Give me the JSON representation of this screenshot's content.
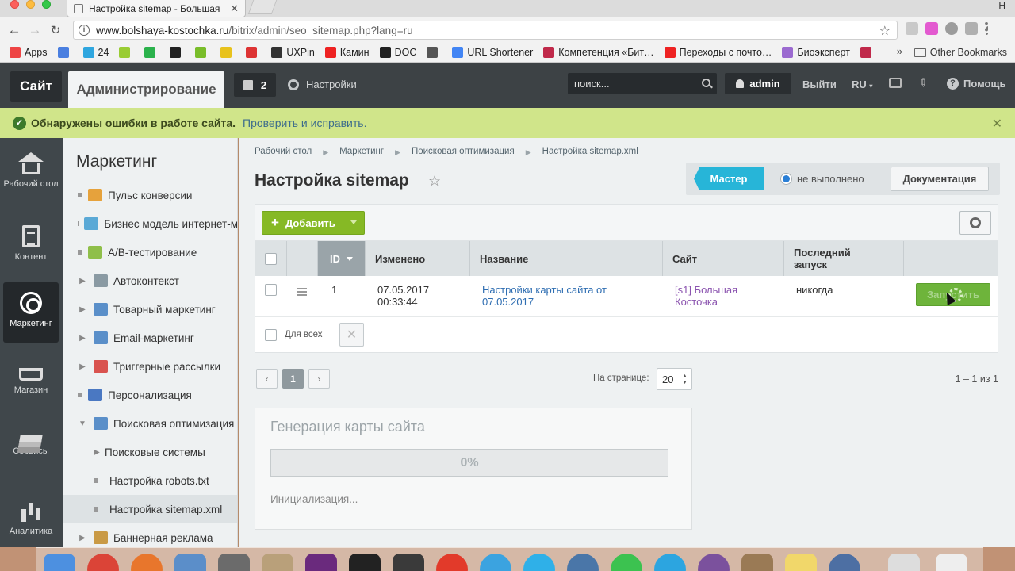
{
  "browser": {
    "tab_title": "Настройка sitemap - Большая",
    "window_letter": "H",
    "url_host": "www.bolshaya-kostochka.ru",
    "url_path": "/bitrix/admin/seo_sitemap.php?lang=ru",
    "bookmarks": [
      {
        "label": "Apps",
        "icon": "apps-grid-icon",
        "color": "#e44"
      },
      {
        "label": "",
        "icon": "translate-icon",
        "color": "#4a7fe0"
      },
      {
        "label": "24",
        "icon": "bitrix24-icon",
        "color": "#2fa6df"
      },
      {
        "label": "",
        "icon": "extension-icon",
        "color": "#9c3"
      },
      {
        "label": "",
        "icon": "evernote-icon",
        "color": "#2bb24c"
      },
      {
        "label": "",
        "icon": "tool-icon",
        "color": "#222"
      },
      {
        "label": "",
        "icon": "feedly-icon",
        "color": "#79bd2a"
      },
      {
        "label": "",
        "icon": "shield-icon",
        "color": "#e8c21c"
      },
      {
        "label": "",
        "icon": "letter-a-icon",
        "color": "#d33"
      },
      {
        "label": "UXPin",
        "icon": "uxpin-icon",
        "color": "#333"
      },
      {
        "label": "Камин",
        "icon": "youtube-icon",
        "color": "#e22"
      },
      {
        "label": "DOC",
        "icon": "doc-icon",
        "color": "#222"
      },
      {
        "label": "",
        "icon": "chart-icon",
        "color": "#555"
      },
      {
        "label": "URL Shortener",
        "icon": "google-icon",
        "color": "#4285f4"
      },
      {
        "label": "Компетенция «Бит…",
        "icon": "competence-icon",
        "color": "#c0294a"
      },
      {
        "label": "Переходы с почто…",
        "icon": "yandex-icon",
        "color": "#e22"
      },
      {
        "label": "Биоэксперт",
        "icon": "bioexpert-icon",
        "color": "#9b6ad0"
      },
      {
        "label": "",
        "icon": "competence-icon",
        "color": "#c0294a"
      }
    ],
    "more": "»",
    "other_bookmarks": "Other Bookmarks"
  },
  "admin_panel": {
    "site_label": "Сайт",
    "admin_label": "Администрирование",
    "notifications_count": "2",
    "settings_label": "Настройки",
    "search_placeholder": "поиск...",
    "user": "admin",
    "logout": "Выйти",
    "lang": "RU",
    "help": "Помощь"
  },
  "error_bar": {
    "message": "Обнаружены ошибки в работе сайта.",
    "link": "Проверить и исправить."
  },
  "iconbar": [
    {
      "label": "Рабочий стол",
      "icon": "home-icon",
      "active": false
    },
    {
      "label": "Контент",
      "icon": "document-icon",
      "active": false
    },
    {
      "label": "Маркетинг",
      "icon": "target-icon",
      "active": true
    },
    {
      "label": "Магазин",
      "icon": "basket-icon",
      "active": false
    },
    {
      "label": "Сервисы",
      "icon": "layers-icon",
      "active": false
    },
    {
      "label": "Аналитика",
      "icon": "bar-chart-icon",
      "active": false
    }
  ],
  "menu": {
    "title": "Маркетинг",
    "items": [
      {
        "label": "Пульс конверсии",
        "marker": "dot",
        "icon_color": "#e6a23c"
      },
      {
        "label": "Бизнес модель интернет-м",
        "marker": "dot",
        "icon_color": "#5aa9d6"
      },
      {
        "label": "A/B-тестирование",
        "marker": "dot",
        "icon_color": "#8fbf4a"
      },
      {
        "label": "Автоконтекст",
        "marker": "arrow",
        "icon_color": "#8a9aa3"
      },
      {
        "label": "Товарный маркетинг",
        "marker": "arrow",
        "icon_color": "#5a8fc9"
      },
      {
        "label": "Email-маркетинг",
        "marker": "arrow",
        "icon_color": "#5a8fc9"
      },
      {
        "label": "Триггерные рассылки",
        "marker": "arrow",
        "icon_color": "#d9534f"
      },
      {
        "label": "Персонализация",
        "marker": "dot",
        "icon_color": "#4a78c2"
      },
      {
        "label": "Поисковая оптимизация",
        "marker": "open",
        "icon_color": "#5a8fc9"
      },
      {
        "label": "Поисковые системы",
        "marker": "sub-arrow"
      },
      {
        "label": "Настройка robots.txt",
        "marker": "sub-dot"
      },
      {
        "label": "Настройка sitemap.xml",
        "marker": "sub-dot",
        "active": true
      },
      {
        "label": "Баннерная реклама",
        "marker": "arrow",
        "icon_color": "#c99a45"
      }
    ]
  },
  "breadcrumb": [
    "Рабочий стол",
    "Маркетинг",
    "Поисковая оптимизация",
    "Настройка sitemap.xml"
  ],
  "page": {
    "title": "Настройка sitemap",
    "master_label": "Мастер",
    "master_status": "не выполнено",
    "docs_label": "Документация"
  },
  "grid": {
    "add_label": "Добавить",
    "columns": [
      "ID",
      "Изменено",
      "Название",
      "Сайт",
      "Последний запуск"
    ],
    "rows": [
      {
        "id": "1",
        "modified": "07.05.2017 00:33:44",
        "name": "Настройки карты сайта от 07.05.2017",
        "site": "[s1] Большая Косточка",
        "last_run": "никогда",
        "action": "Запустить"
      }
    ],
    "for_all": "Для всех"
  },
  "pager": {
    "prev": "‹",
    "current": "1",
    "next": "›",
    "per_page_label": "На странице:",
    "per_page": "20",
    "total": "1 – 1 из 1"
  },
  "generation": {
    "title": "Генерация карты сайта",
    "progress_text": "0%",
    "progress_value": 0,
    "status": "Инициализация..."
  },
  "colors": {
    "accent_green": "#86b925",
    "master_blue": "#27b5d8",
    "error_bar": "#d0e58a",
    "topbar": "#3d4245"
  }
}
